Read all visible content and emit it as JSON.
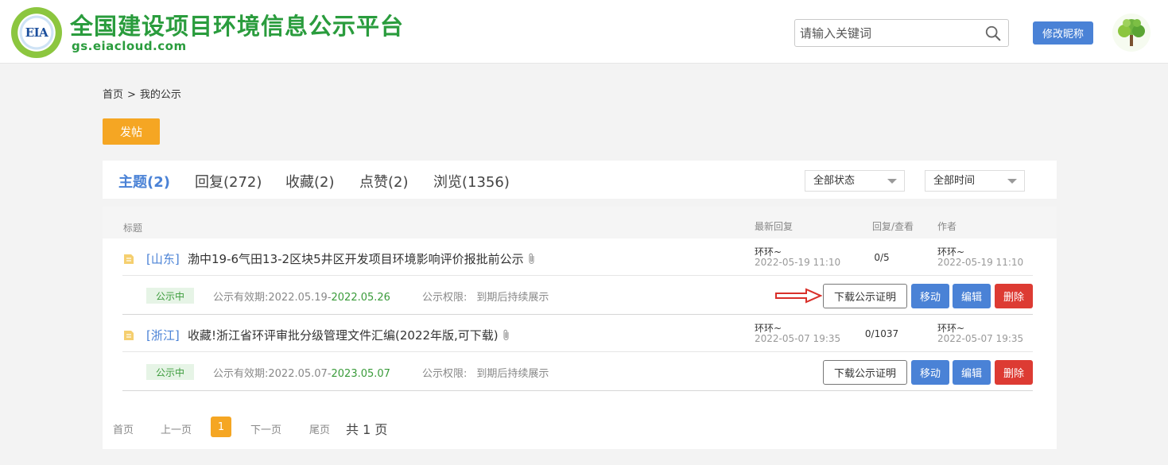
{
  "header": {
    "logo_text": "EIA",
    "site_title": "全国建设项目环境信息公示平台",
    "site_domain": "gs.eiacloud.com",
    "search_placeholder": "请输入关键词",
    "nickname_button": "修改昵称",
    "icons": {
      "search": "search-icon",
      "avatar": "tree-avatar"
    }
  },
  "breadcrumb": {
    "home": "首页",
    "separator": ">",
    "current": "我的公示"
  },
  "post_button": "发帖",
  "tabs": [
    {
      "label": "主题(2)",
      "active": true
    },
    {
      "label": "回复(272)",
      "active": false
    },
    {
      "label": "收藏(2)",
      "active": false
    },
    {
      "label": "点赞(2)",
      "active": false
    },
    {
      "label": "浏览(1356)",
      "active": false
    }
  ],
  "filters": {
    "status": "全部状态",
    "time": "全部时间"
  },
  "columns": {
    "title": "标题",
    "latest_reply": "最新回复",
    "reply_view": "回复/查看",
    "author": "作者"
  },
  "items": [
    {
      "region": "[山东]",
      "title": "渤中19-6气田13-2区块5井区开发项目环境影响评价报批前公示",
      "reply_user": "环环~",
      "reply_time": "2022-05-19 11:10",
      "reply_count": "0/5",
      "author": "环环~",
      "author_time": "2022-05-19 11:10",
      "status": "公示中",
      "validity_label": "公示有效期:",
      "validity_start": "2022.05.19-",
      "validity_end": "2022.05.26",
      "perm_label": "公示权限:",
      "perm_value": "到期后持续展示",
      "actions": {
        "download": "下载公示证明",
        "move": "移动",
        "edit": "编辑",
        "delete": "删除"
      }
    },
    {
      "region": "[浙江]",
      "title": "收藏!浙江省环评审批分级管理文件汇编(2022年版,可下载)",
      "reply_user": "环环~",
      "reply_time": "2022-05-07 19:35",
      "reply_count": "0/1037",
      "author": "环环~",
      "author_time": "2022-05-07 19:35",
      "status": "公示中",
      "validity_label": "公示有效期:",
      "validity_start": "2022.05.07-",
      "validity_end": "2023.05.07",
      "perm_label": "公示权限:",
      "perm_value": "到期后持续展示",
      "actions": {
        "download": "下载公示证明",
        "move": "移动",
        "edit": "编辑",
        "delete": "删除"
      }
    }
  ],
  "pagination": {
    "first": "首页",
    "prev": "上一页",
    "current": "1",
    "next": "下一页",
    "last": "尾页",
    "total": "共 1 页"
  },
  "colors": {
    "brand_green": "#2a9c3d",
    "accent_blue": "#4a82d6",
    "orange": "#f5a623",
    "danger_red": "#dd3b33",
    "annotation_arrow": "#d9302a"
  }
}
